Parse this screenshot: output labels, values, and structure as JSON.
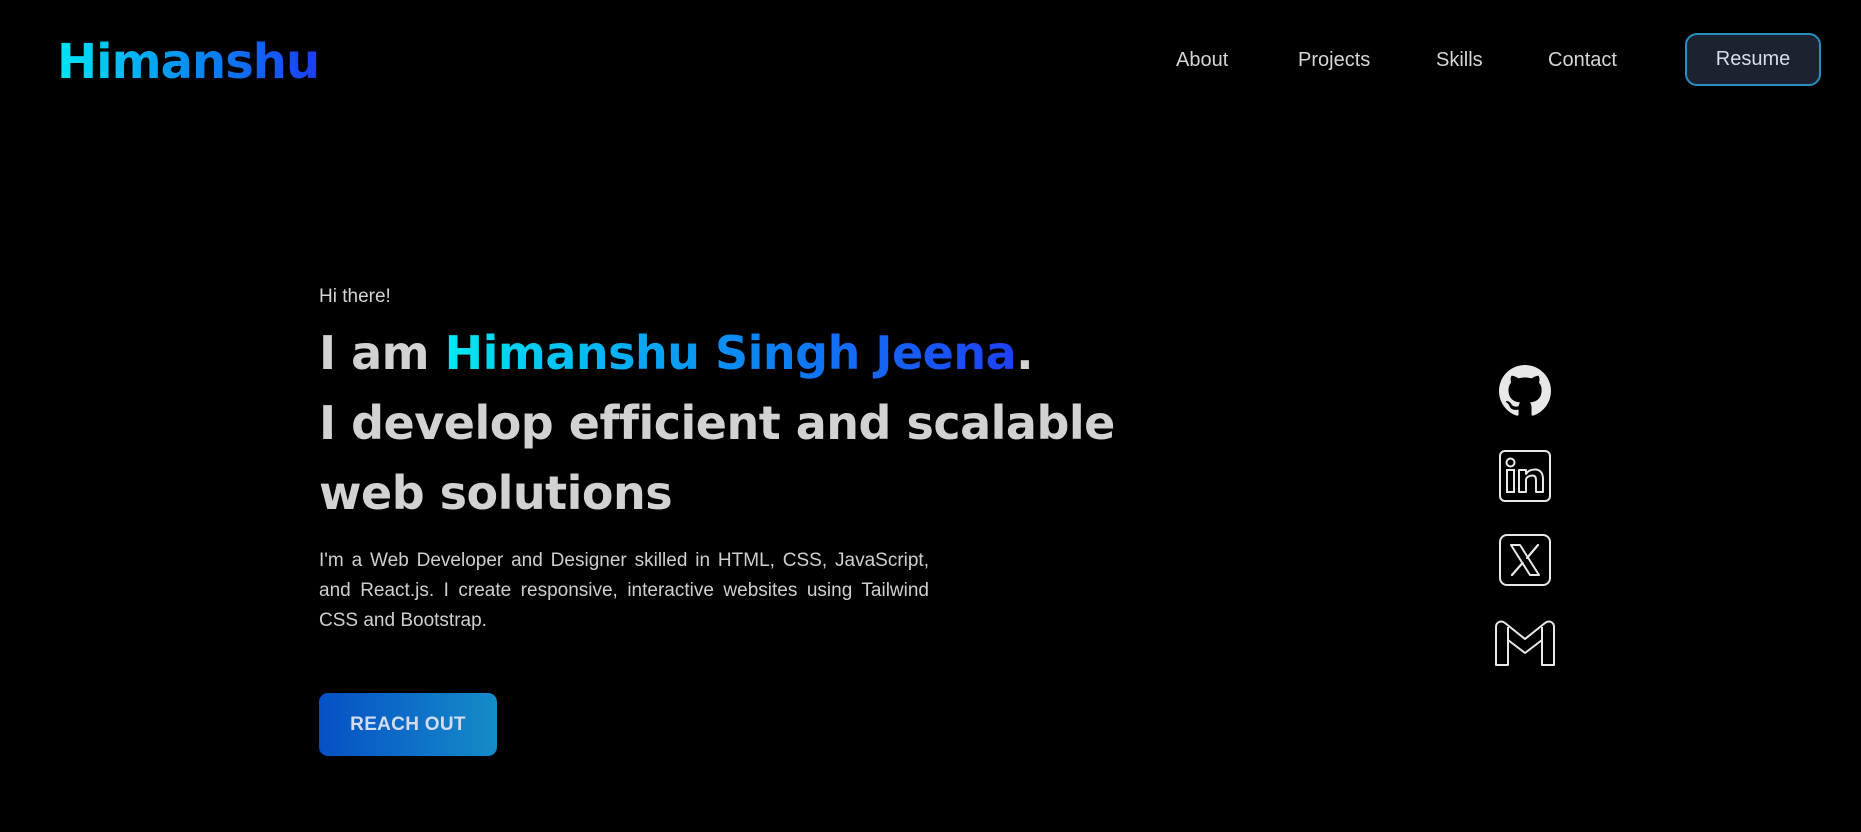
{
  "header": {
    "logo": "Himanshu",
    "nav": [
      {
        "label": "About"
      },
      {
        "label": "Projects"
      },
      {
        "label": "Skills"
      },
      {
        "label": "Contact"
      }
    ],
    "resume_label": "Resume"
  },
  "hero": {
    "greeting": "Hi there!",
    "intro_prefix": "I am ",
    "name": "Himanshu Singh Jeena",
    "intro_suffix": ".",
    "tagline_line1": "I develop efficient and scalable",
    "tagline_line2": "web solutions",
    "description": "I'm a Web Developer and Designer skilled in HTML, CSS, JavaScript, and React.js. I create responsive, interactive websites using Tailwind CSS and Bootstrap.",
    "cta_label": "REACH OUT"
  },
  "social": [
    {
      "icon": "github-icon"
    },
    {
      "icon": "linkedin-icon"
    },
    {
      "icon": "x-twitter-icon"
    },
    {
      "icon": "gmail-icon"
    }
  ],
  "colors": {
    "background": "#000000",
    "gradient_start": "#00e5f5",
    "gradient_end": "#1c3cf5",
    "text": "#d4d4d4",
    "cta_start": "#0650c6",
    "cta_end": "#158cc8"
  }
}
